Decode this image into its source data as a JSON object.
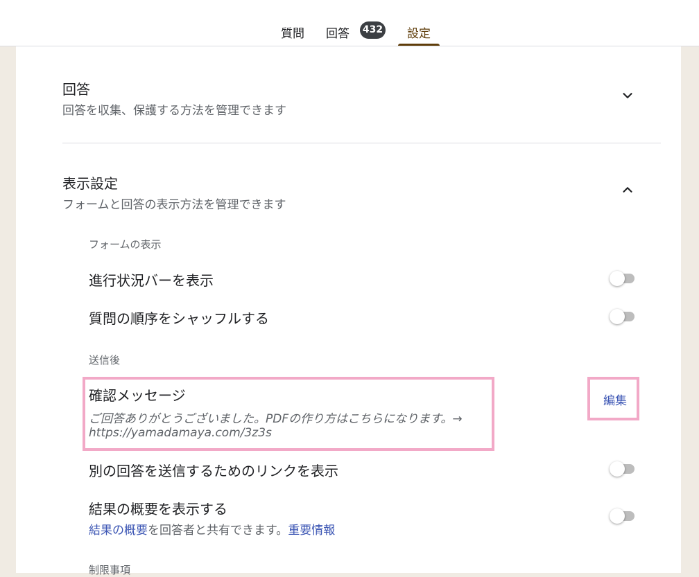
{
  "tabs": {
    "questions": "質問",
    "responses": "回答",
    "responses_count": "432",
    "settings": "設定"
  },
  "responses_section": {
    "title": "回答",
    "description": "回答を収集、保護する方法を管理できます"
  },
  "presentation_section": {
    "title": "表示設定",
    "description": "フォームと回答の表示方法を管理できます",
    "form_display": {
      "heading": "フォームの表示",
      "progress_bar_label": "進行状況バーを表示",
      "progress_bar_on": false,
      "shuffle_label": "質問の順序をシャッフルする",
      "shuffle_on": false
    },
    "after_submit": {
      "heading": "送信後",
      "confirmation_title": "確認メッセージ",
      "confirmation_message_line1": "ご回答ありがとうございました。PDFの作り方はこちらになります。→",
      "confirmation_message_line2": "https://yamadamaya.com/3z3s",
      "edit_label": "編集",
      "another_response_label": "別の回答を送信するためのリンクを表示",
      "another_response_on": false,
      "summary_label": "結果の概要を表示する",
      "summary_on": false,
      "summary_desc_link": "結果の概要",
      "summary_desc_text": "を回答者と共有できます。",
      "summary_desc_info_link": "重要情報"
    },
    "restrictions_heading": "制限事項"
  },
  "colors": {
    "accent": "#5f3d0a",
    "highlight": "#f2a9c7",
    "link": "#3c56b4"
  }
}
